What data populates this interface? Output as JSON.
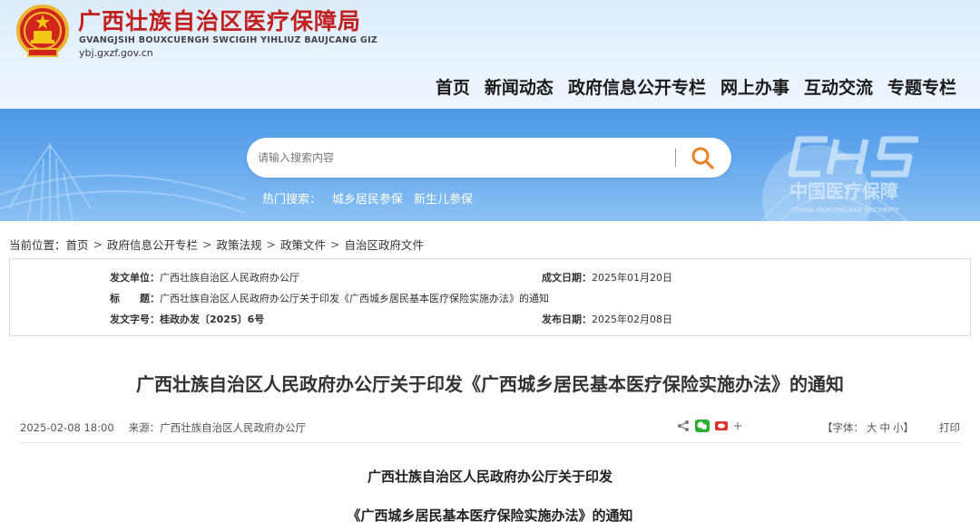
{
  "header": {
    "title": "广西壮族自治区医疗保障局",
    "pinyin": "GVANGJSIH BOUXCUENGH SWCIGIH YIHLIUZ BAUJCANG GIZ",
    "domain": "ybj.gxzf.gov.cn"
  },
  "nav": [
    "首页",
    "新闻动态",
    "政府信息公开专栏",
    "网上办事",
    "互动交流",
    "专题专栏"
  ],
  "search": {
    "placeholder": "请输入搜索内容",
    "hot_label": "热门搜索：",
    "hot_items": [
      "城乡居民参保",
      "新生儿参保"
    ]
  },
  "breadcrumb": {
    "label": "当前位置：",
    "items": [
      "首页",
      "政府信息公开专栏",
      "政策法规",
      "政策文件",
      "自治区政府文件"
    ]
  },
  "info": {
    "issuer_label": "发文单位：",
    "issuer": "广西壮族自治区人民政府办公厅",
    "date_label": "成文日期：",
    "date": "2025年01月20日",
    "title_label": "标　　题：",
    "title": "广西壮族自治区人民政府办公厅关于印发《广西城乡居民基本医疗保险实施办法》的通知",
    "docno_label": "发文字号：",
    "docno": "桂政办发〔2025〕6号",
    "pubdate_label": "发布日期：",
    "pubdate": "2025年02月08日"
  },
  "article": {
    "title": "广西壮族自治区人民政府办公厅关于印发《广西城乡居民基本医疗保险实施办法》的通知",
    "datetime": "2025-02-08 18:00",
    "source": "来源：广西壮族自治区人民政府办公厅",
    "font_label": "【字体：",
    "font_large": "大",
    "font_medium": "中",
    "font_small": "小",
    "font_close": "】",
    "print": "打印",
    "body_line1": "广西壮族自治区人民政府办公厅关于印发",
    "body_line2": "《广西城乡居民基本医疗保险实施办法》的通知"
  },
  "colors": {
    "title_red": "#c21f1f",
    "banner_blue": "#5aa2ea",
    "search_orange": "#e8822a"
  },
  "icons": [
    "national-emblem-icon",
    "search-icon",
    "share-icon",
    "wechat-icon",
    "weibo-icon",
    "plus-icon",
    "chs-logo-icon"
  ]
}
